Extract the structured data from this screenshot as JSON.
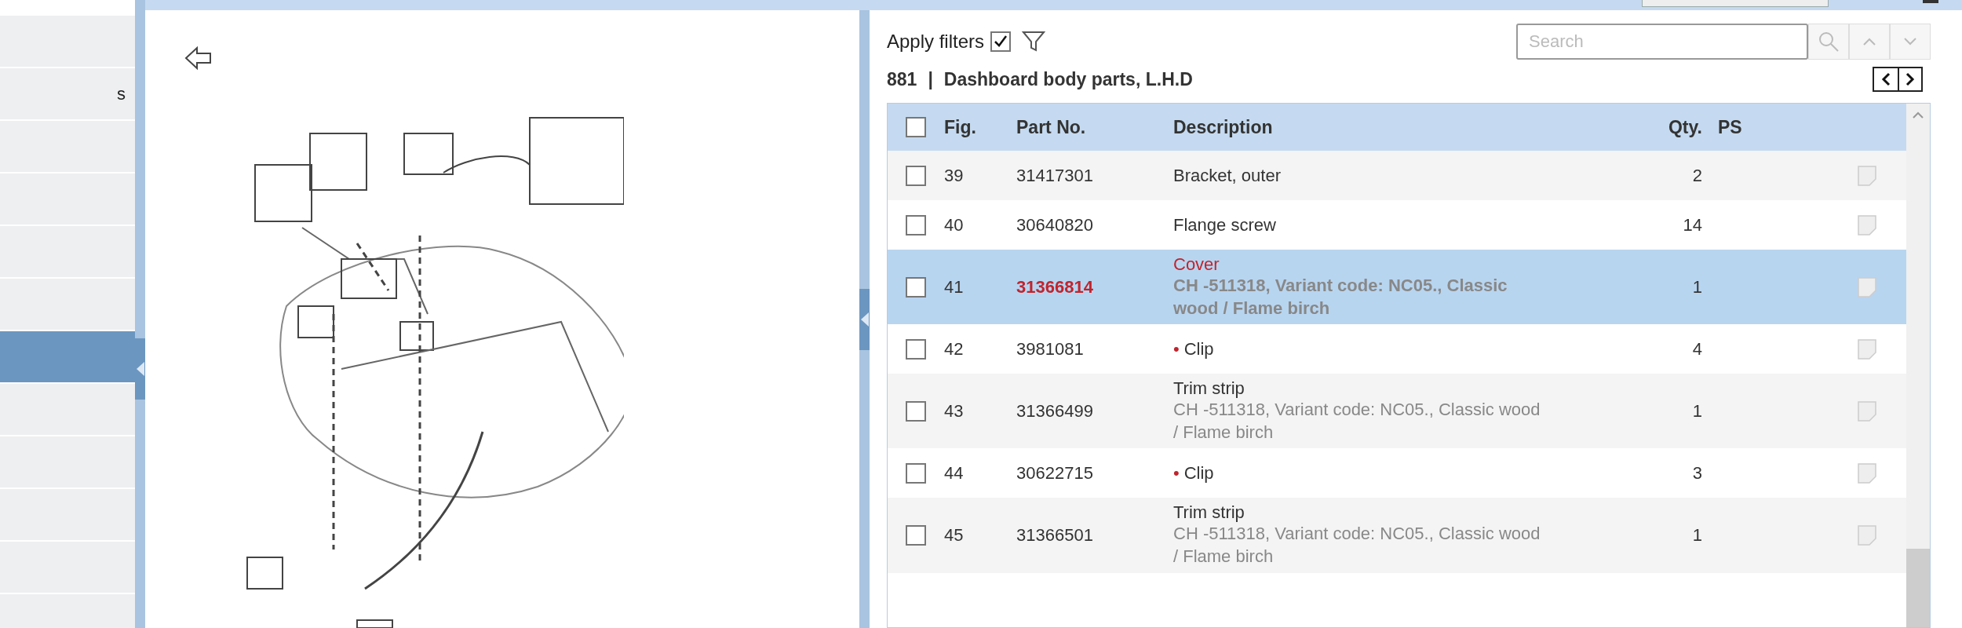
{
  "sidebar": {
    "items": [
      {
        "selected": false
      },
      {
        "label": "s",
        "selected": false
      },
      {
        "selected": false
      },
      {
        "selected": false
      },
      {
        "selected": false
      },
      {
        "selected": false
      },
      {
        "selected": true
      },
      {
        "selected": false
      },
      {
        "selected": false
      },
      {
        "selected": false
      },
      {
        "selected": false
      },
      {
        "selected": false
      }
    ]
  },
  "toolbar": {
    "apply_filters": {
      "label": "Apply filters",
      "checked": true
    },
    "search": {
      "placeholder": "Search"
    }
  },
  "group": {
    "number": "881",
    "separator": "|",
    "title": "Dashboard body parts, L.H.D"
  },
  "table": {
    "select_all": {
      "checked": false
    },
    "columns": [
      "Fig.",
      "Part No.",
      "Description",
      "Qty.",
      "PS"
    ],
    "rows": [
      {
        "fig": "39",
        "part_no": "31417301",
        "description": "Bracket, outer",
        "qty": "2",
        "checked": false,
        "selected": false
      },
      {
        "fig": "40",
        "part_no": "30640820",
        "description": "Flange screw",
        "qty": "14",
        "checked": false,
        "selected": false
      },
      {
        "fig": "41",
        "part_no": "31366814",
        "description": "Cover",
        "detail": "CH -511318, Variant code: NC05., Classic wood / Flame birch",
        "qty": "1",
        "checked": false,
        "selected": true
      },
      {
        "fig": "42",
        "part_no": "3981081",
        "bullet": "•",
        "description": "Clip",
        "qty": "4",
        "checked": false,
        "selected": false
      },
      {
        "fig": "43",
        "part_no": "31366499",
        "description": "Trim strip",
        "detail": "CH -511318, Variant code: NC05., Classic wood / Flame birch",
        "qty": "1",
        "checked": false,
        "selected": false
      },
      {
        "fig": "44",
        "part_no": "30622715",
        "bullet": "•",
        "description": "Clip",
        "qty": "3",
        "checked": false,
        "selected": false
      },
      {
        "fig": "45",
        "part_no": "31366501",
        "description": "Trim strip",
        "detail": "CH -511318, Variant code: NC05., Classic wood / Flame birch",
        "qty": "1",
        "checked": false,
        "selected": false
      }
    ]
  }
}
